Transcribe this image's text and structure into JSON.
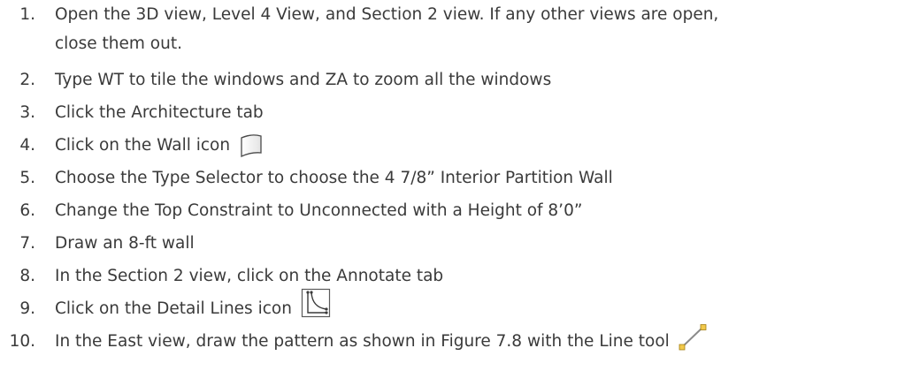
{
  "steps": [
    {
      "number": "1.",
      "text": "Open the 3D view, Level 4 View, and Section 2 view. If any other views are open,",
      "text_cont": "close them out."
    },
    {
      "number": "2.",
      "text": "Type WT to tile the windows and ZA to zoom all the windows"
    },
    {
      "number": "3.",
      "text": "Click the Architecture tab"
    },
    {
      "number": "4.",
      "text": "Click on the Wall icon",
      "icon": "wall-icon"
    },
    {
      "number": "5.",
      "text": "Choose the Type Selector to choose the 4 7/8” Interior Partition Wall"
    },
    {
      "number": "6.",
      "text": "Change the Top Constraint to Unconnected with a Height of 8’0”"
    },
    {
      "number": "7.",
      "text": "Draw an 8-ft wall"
    },
    {
      "number": "8.",
      "text": "In the Section 2 view, click on the Annotate tab"
    },
    {
      "number": "9.",
      "text": "Click on the Detail Lines icon",
      "icon": "detail-lines-icon"
    },
    {
      "number": "10.",
      "text": "In the East view, draw the pattern as shown in Figure 7.8 with the Line tool",
      "icon": "line-tool-icon"
    }
  ]
}
